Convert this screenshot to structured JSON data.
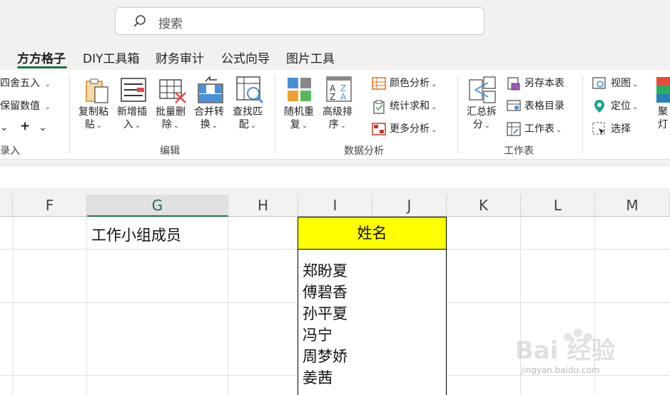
{
  "search": {
    "placeholder": "搜索"
  },
  "tabs": [
    {
      "label": "方方格子",
      "active": true
    },
    {
      "label": "DIY工具箱"
    },
    {
      "label": "财务审计"
    },
    {
      "label": "公式向导"
    },
    {
      "label": "图片工具"
    }
  ],
  "ribbon": {
    "left_partial": {
      "round": "四舍五入",
      "keep": "保留数值",
      "plus": "+",
      "group": "录入"
    },
    "edit_group": {
      "copy_paste": [
        "复制粘",
        "贴"
      ],
      "insert": [
        "新增插",
        "入"
      ],
      "batch_delete": [
        "批量删",
        "除"
      ],
      "merge": [
        "合并转",
        "换"
      ],
      "lookup": [
        "查找匹",
        "配"
      ],
      "group_label": "编辑"
    },
    "analysis_group": {
      "random": [
        "随机重",
        "复"
      ],
      "sort": [
        "高级排",
        "序"
      ],
      "color_analysis": "颜色分析",
      "stat_sum": "统计求和",
      "more_analysis": "更多分析",
      "group_label": "数据分析"
    },
    "sheet_group": {
      "split": [
        "汇总拆",
        "分"
      ],
      "save_as": "另存本表",
      "catalog": "表格目录",
      "worksheet": "工作表",
      "group_label": "工作表"
    },
    "view_group": {
      "view": "视图",
      "locate": "定位",
      "select": "选择",
      "focus": [
        "聚",
        "灯"
      ]
    }
  },
  "sheet": {
    "columns": [
      "F",
      "G",
      "H",
      "I",
      "J",
      "K",
      "L",
      "M"
    ],
    "selected_column": "G",
    "g_header_cell": "工作小组成员",
    "name_header": "姓名",
    "names": [
      "郑盼夏",
      "傅碧香",
      "孙平夏",
      "冯宁",
      "周梦娇",
      "姜茜"
    ]
  },
  "colors": {
    "accent": "#217346",
    "highlight": "#ffff00"
  },
  "watermark": {
    "text": "Bai 经验",
    "url_text": "jingyan.baidu.com"
  }
}
